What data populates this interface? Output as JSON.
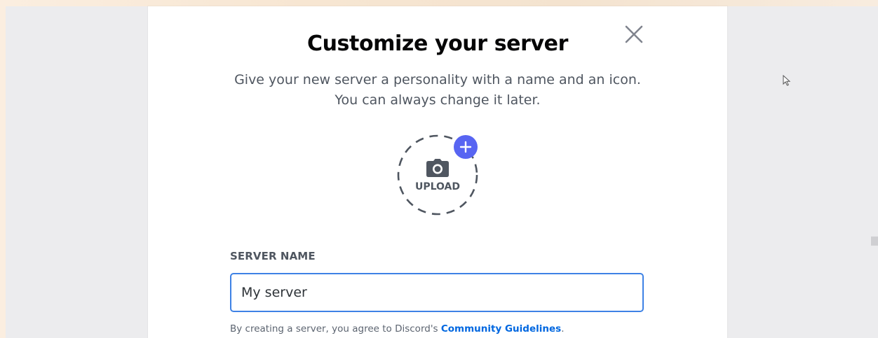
{
  "dialog": {
    "title": "Customize your server",
    "subtitle_line1": "Give your new server a personality with a name and an icon.",
    "subtitle_line2": "You can always change it later.",
    "close_icon": "close-icon"
  },
  "upload": {
    "label": "UPLOAD",
    "icon": "camera-icon",
    "badge_icon": "plus-icon"
  },
  "server_name": {
    "label": "SERVER NAME",
    "value": "My server"
  },
  "terms": {
    "prefix": "By creating a server, you agree to Discord's ",
    "link": "Community Guidelines",
    "suffix": "."
  },
  "colors": {
    "accent": "#5865f2",
    "link": "#0067e0",
    "input_focus_border": "#3e82e5",
    "title": "#060607",
    "muted_text": "#4f5660",
    "overlay": "#ececee"
  }
}
